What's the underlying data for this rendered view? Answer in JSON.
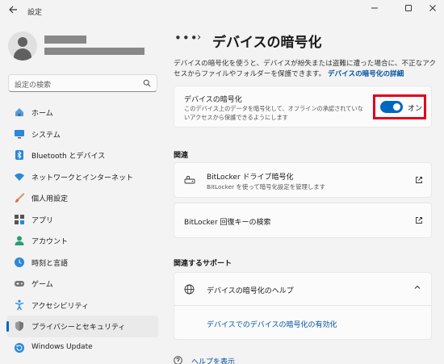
{
  "window": {
    "app_title": "設定",
    "back_icon": "back-arrow-icon",
    "controls": [
      "minimize-icon",
      "maximize-icon",
      "close-icon"
    ]
  },
  "search": {
    "placeholder": "設定の検索"
  },
  "sidebar": {
    "items": [
      {
        "label": "ホーム",
        "icon": "home-icon",
        "active": false
      },
      {
        "label": "システム",
        "icon": "system-icon",
        "active": false
      },
      {
        "label": "Bluetooth とデバイス",
        "icon": "bluetooth-icon",
        "active": false
      },
      {
        "label": "ネットワークとインターネット",
        "icon": "network-icon",
        "active": false
      },
      {
        "label": "個人用設定",
        "icon": "brush-icon",
        "active": false
      },
      {
        "label": "アプリ",
        "icon": "apps-icon",
        "active": false
      },
      {
        "label": "アカウント",
        "icon": "account-icon",
        "active": false
      },
      {
        "label": "時刻と言語",
        "icon": "time-language-icon",
        "active": false
      },
      {
        "label": "ゲーム",
        "icon": "gamepad-icon",
        "active": false
      },
      {
        "label": "アクセシビリティ",
        "icon": "accessibility-icon",
        "active": false
      },
      {
        "label": "プライバシーとセキュリティ",
        "icon": "shield-icon",
        "active": true
      },
      {
        "label": "Windows Update",
        "icon": "update-icon",
        "active": false
      }
    ]
  },
  "main": {
    "breadcrumb_dots": "•••",
    "page_title": "デバイスの暗号化",
    "description": "デバイスの暗号化を使うと、デバイスが紛失または盗難に遭った場合に、不正なアクセスからファイルやフォルダーを保護できます。",
    "description_link": "デバイスの暗号化の詳細",
    "toggle_card": {
      "title": "デバイスの暗号化",
      "description": "このデバイス上のデータを暗号化して、オフラインの承認されていないアクセスから保護できるようにします",
      "state_label": "オン",
      "enabled": true
    },
    "related": {
      "heading": "関連",
      "bitlocker": {
        "title": "BitLocker ドライブ暗号化",
        "subtitle": "BitLocker を使って暗号化設定を管理します",
        "icon": "bitlocker-key-icon"
      },
      "recovery": {
        "title": "BitLocker 回復キーの検索"
      }
    },
    "support": {
      "heading": "関連するサポート",
      "title": "デバイスの暗号化のヘルプ",
      "link": "デバイスでのデバイスの暗号化の有効化"
    },
    "help_link": "ヘルプを表示"
  },
  "colors": {
    "accent": "#0067c0",
    "highlight_border": "#e0001b",
    "background": "#f3f3f3"
  }
}
